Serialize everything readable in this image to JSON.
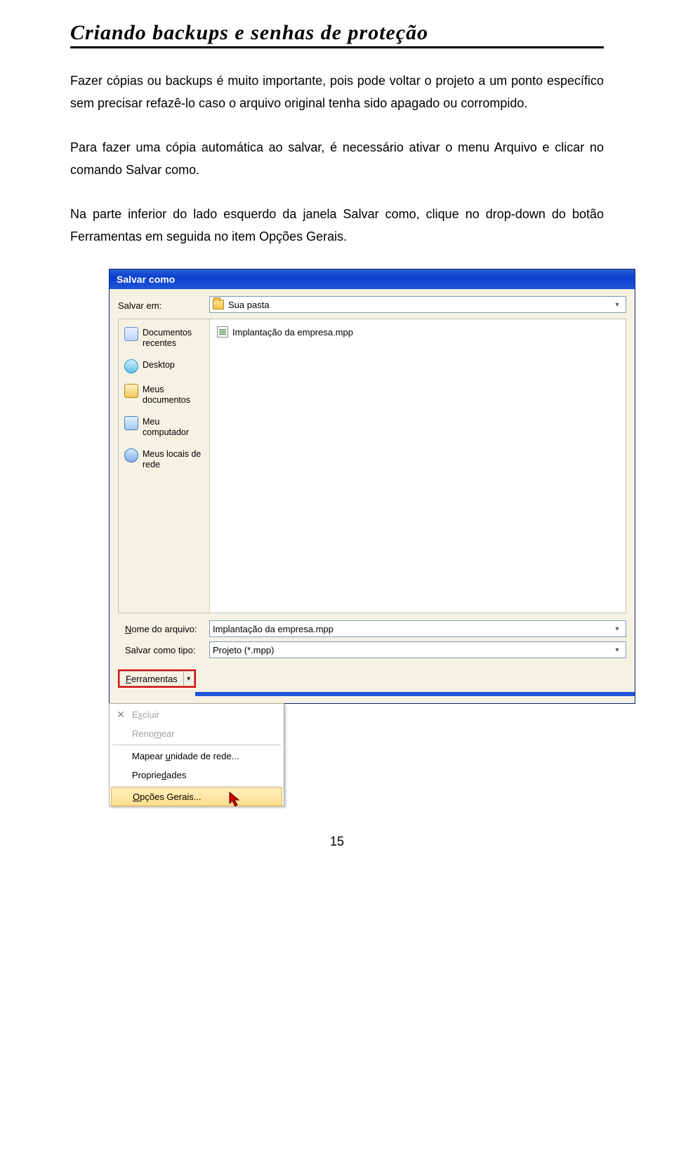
{
  "section_title": "Criando backups e senhas de proteção",
  "para1": "Fazer cópias ou backups é muito importante, pois pode voltar o projeto a um ponto específico sem precisar refazê-lo caso o arquivo original tenha sido apagado ou corrompido.",
  "para2": "Para fazer uma cópia automática ao salvar, é necessário ativar o menu Arquivo e clicar no comando Salvar como.",
  "para3": "Na parte inferior do lado esquerdo da janela Salvar como, clique no drop-down do botão Ferramentas em seguida no item Opções Gerais.",
  "dialog": {
    "title": "Salvar como",
    "save_in_label": "Salvar em:",
    "save_in_value": "Sua pasta",
    "places": {
      "recent": "Documentos recentes",
      "desktop": "Desktop",
      "mydocs": "Meus documentos",
      "mycomp": "Meu computador",
      "network": "Meus locais de rede"
    },
    "file_listed": "Implantação da empresa.mpp",
    "filename_label": "Nome do arquivo:",
    "filename_value": "Implantação da empresa.mpp",
    "filetype_label": "Salvar como tipo:",
    "filetype_value": "Projeto (*.mpp)",
    "tools_label": "Ferramentas",
    "menu": {
      "excluir": "Excluir",
      "renomear": "Renomear",
      "mapear": "Mapear unidade de rede...",
      "propriedades": "Propriedades",
      "opcoes": "Opções Gerais..."
    }
  },
  "page_number": "15"
}
